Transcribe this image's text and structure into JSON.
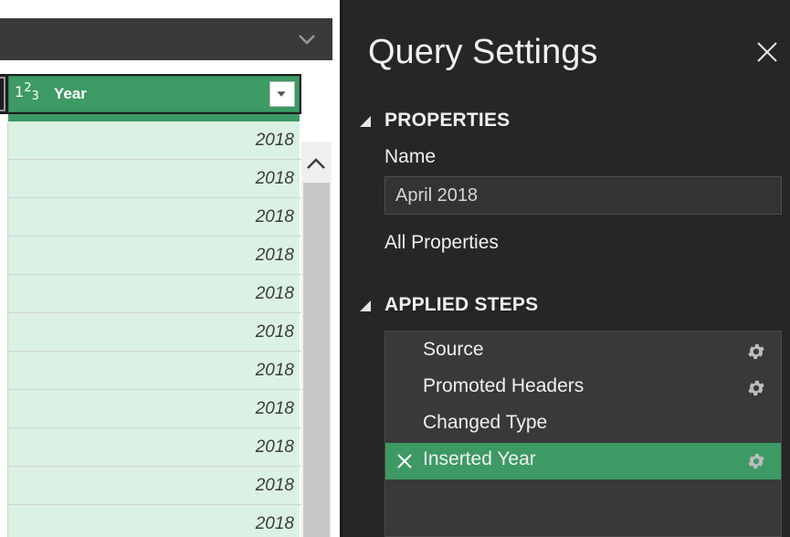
{
  "grid": {
    "column": {
      "type_icon": "number-type-icon",
      "name": "Year"
    },
    "rows": [
      "2018",
      "2018",
      "2018",
      "2018",
      "2018",
      "2018",
      "2018",
      "2018",
      "2018",
      "2018",
      "2018"
    ]
  },
  "query_settings": {
    "title": "Query Settings",
    "properties": {
      "heading": "PROPERTIES",
      "name_label": "Name",
      "name_value": "April 2018",
      "all_properties": "All Properties"
    },
    "applied_steps": {
      "heading": "APPLIED STEPS",
      "steps": [
        {
          "label": "Source",
          "has_settings": true,
          "selected": false
        },
        {
          "label": "Promoted Headers",
          "has_settings": true,
          "selected": false
        },
        {
          "label": "Changed Type",
          "has_settings": false,
          "selected": false
        },
        {
          "label": "Inserted Year",
          "has_settings": true,
          "selected": true
        }
      ]
    }
  },
  "colors": {
    "accent": "#3d9a65",
    "cell_bg": "#dbf1e4",
    "panel_bg": "#262626"
  }
}
